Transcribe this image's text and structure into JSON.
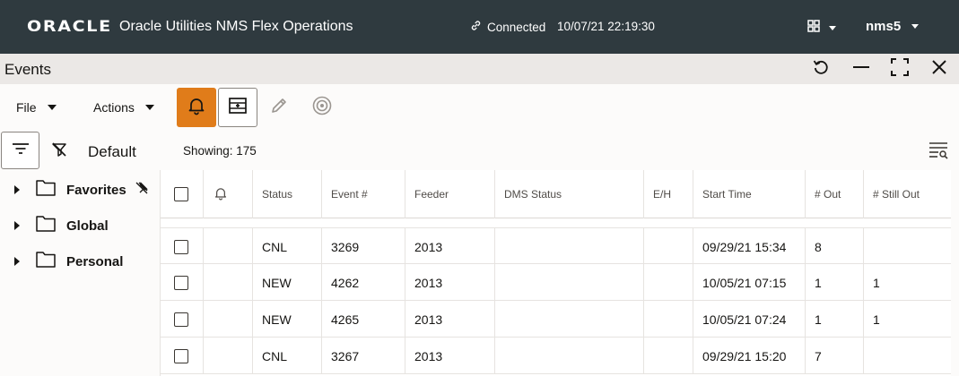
{
  "header": {
    "logo": "ORACLE",
    "app_title": "Oracle Utilities NMS Flex Operations",
    "connection_status": "Connected",
    "timestamp": "10/07/21 22:19:30",
    "user": "nms5"
  },
  "window": {
    "title": "Events"
  },
  "toolbar": {
    "file_label": "File",
    "actions_label": "Actions"
  },
  "filter": {
    "view_name": "Default",
    "showing_text": "Showing: 175"
  },
  "tree": {
    "items": [
      {
        "label": "Favorites"
      },
      {
        "label": "Global"
      },
      {
        "label": "Personal"
      }
    ]
  },
  "table": {
    "columns": [
      "Status",
      "Event #",
      "Feeder",
      "DMS Status",
      "E/H",
      "Start Time",
      "# Out",
      "# Still Out"
    ],
    "rows": [
      {
        "status": "CNL",
        "event": "3269",
        "feeder": "2013",
        "dms_status": "",
        "eh": "",
        "start_time": "09/29/21 15:34",
        "out": "8",
        "still_out": ""
      },
      {
        "status": "NEW",
        "event": "4262",
        "feeder": "2013",
        "dms_status": "",
        "eh": "",
        "start_time": "10/05/21 07:15",
        "out": "1",
        "still_out": "1"
      },
      {
        "status": "NEW",
        "event": "4265",
        "feeder": "2013",
        "dms_status": "",
        "eh": "",
        "start_time": "10/05/21 07:24",
        "out": "1",
        "still_out": "1"
      },
      {
        "status": "CNL",
        "event": "3267",
        "feeder": "2013",
        "dms_status": "",
        "eh": "",
        "start_time": "09/29/21 15:20",
        "out": "7",
        "still_out": ""
      }
    ]
  },
  "colors": {
    "header_bg": "#2f3a3f",
    "window_bar_bg": "#ebe8e6",
    "accent_active": "#e07c1a"
  },
  "icons": [
    "link-icon",
    "apps-grid-icon",
    "refresh-icon",
    "minimize-icon",
    "maximize-icon",
    "close-icon",
    "bell-icon",
    "add-split-icon",
    "pencil-icon",
    "target-icon",
    "filter-icon",
    "clear-filter-icon",
    "column-search-icon",
    "folder-icon",
    "unpin-icon"
  ]
}
